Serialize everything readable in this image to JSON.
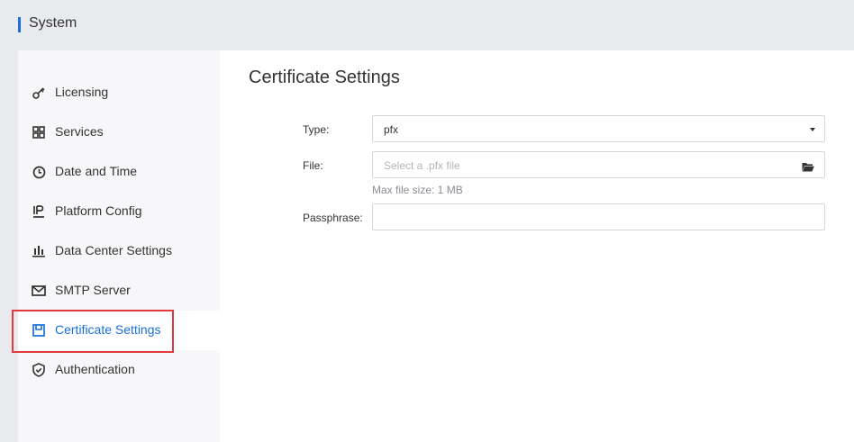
{
  "header": {
    "title": "System"
  },
  "sidebar": {
    "items": [
      {
        "label": "Licensing",
        "icon": "key-icon"
      },
      {
        "label": "Services",
        "icon": "grid-icon"
      },
      {
        "label": "Date and Time",
        "icon": "clock-icon"
      },
      {
        "label": "Platform Config",
        "icon": "ip-icon"
      },
      {
        "label": "Data Center Settings",
        "icon": "bar-chart-icon"
      },
      {
        "label": "SMTP Server",
        "icon": "mail-icon"
      },
      {
        "label": "Certificate Settings",
        "icon": "certificate-icon",
        "active": true
      },
      {
        "label": "Authentication",
        "icon": "shield-icon"
      }
    ]
  },
  "main": {
    "title": "Certificate Settings",
    "form": {
      "type_label": "Type:",
      "type_value": "pfx",
      "file_label": "File:",
      "file_placeholder": "Select a .pfx file",
      "file_hint": "Max file size: 1 MB",
      "passphrase_label": "Passphrase:",
      "passphrase_value": ""
    }
  },
  "colors": {
    "accent": "#1a6fd8",
    "highlight": "#e23b3b"
  }
}
